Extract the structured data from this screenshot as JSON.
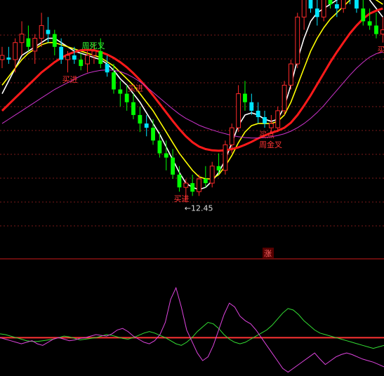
{
  "colors": {
    "background": "#000000",
    "grid": "#7a1a1a",
    "candle_up": "#ff2a2a",
    "candle_down_fill": "#00ff00",
    "candle_flat": "#00e5ff",
    "ma_white": "#ffffff",
    "ma_yellow": "#ffff00",
    "ma_red": "#ff1a1a",
    "ma_magenta": "#cc33cc",
    "ind_green": "#33dd33",
    "ind_magenta": "#dd44dd",
    "signal_red": "#ff3333",
    "signal_green": "#33ff33",
    "price_label": "#dddddd"
  },
  "labels": {
    "rise_tag": "涨",
    "low_price": "←12.45"
  },
  "chart_data": [
    {
      "type": "candlestick",
      "title": "",
      "ylim": [
        11.6,
        17.2
      ],
      "grid": true,
      "min_price": 12.45,
      "candles": [
        {
          "o": 15.9,
          "h": 16.1,
          "l": 15.6,
          "c": 15.8,
          "k": "up"
        },
        {
          "o": 15.8,
          "h": 16.1,
          "l": 15.7,
          "c": 15.85,
          "k": "cyan"
        },
        {
          "o": 15.8,
          "h": 16.3,
          "l": 15.5,
          "c": 16.2,
          "k": "up"
        },
        {
          "o": 16.2,
          "h": 16.7,
          "l": 15.9,
          "c": 16.4,
          "k": "up"
        },
        {
          "o": 16.3,
          "h": 16.6,
          "l": 16.0,
          "c": 16.1,
          "k": "down"
        },
        {
          "o": 16.0,
          "h": 16.4,
          "l": 15.7,
          "c": 16.3,
          "k": "up"
        },
        {
          "o": 16.3,
          "h": 16.9,
          "l": 16.1,
          "c": 16.6,
          "k": "up"
        },
        {
          "o": 16.5,
          "h": 16.8,
          "l": 16.2,
          "c": 16.4,
          "k": "cyan"
        },
        {
          "o": 16.4,
          "h": 16.5,
          "l": 15.9,
          "c": 16.1,
          "k": "down"
        },
        {
          "o": 16.1,
          "h": 16.3,
          "l": 15.7,
          "c": 15.8,
          "k": "cyan"
        },
        {
          "o": 15.8,
          "h": 16.0,
          "l": 15.5,
          "c": 15.9,
          "k": "up"
        },
        {
          "o": 15.9,
          "h": 16.1,
          "l": 15.7,
          "c": 15.8,
          "k": "cyan"
        },
        {
          "o": 15.8,
          "h": 15.95,
          "l": 15.55,
          "c": 15.65,
          "k": "down"
        },
        {
          "o": 15.7,
          "h": 16.0,
          "l": 15.5,
          "c": 15.9,
          "k": "up"
        },
        {
          "o": 15.9,
          "h": 16.2,
          "l": 15.7,
          "c": 16.0,
          "k": "up"
        },
        {
          "o": 16.0,
          "h": 16.3,
          "l": 15.6,
          "c": 15.7,
          "k": "down"
        },
        {
          "o": 15.7,
          "h": 15.9,
          "l": 15.4,
          "c": 15.5,
          "k": "cyan"
        },
        {
          "o": 15.5,
          "h": 15.7,
          "l": 15.0,
          "c": 15.1,
          "k": "down"
        },
        {
          "o": 15.1,
          "h": 15.3,
          "l": 14.7,
          "c": 15.0,
          "k": "down"
        },
        {
          "o": 15.0,
          "h": 15.2,
          "l": 14.6,
          "c": 14.8,
          "k": "down"
        },
        {
          "o": 14.8,
          "h": 15.0,
          "l": 14.4,
          "c": 14.5,
          "k": "down"
        },
        {
          "o": 14.5,
          "h": 14.7,
          "l": 14.1,
          "c": 14.3,
          "k": "down"
        },
        {
          "o": 14.3,
          "h": 14.5,
          "l": 14.0,
          "c": 14.2,
          "k": "cyan"
        },
        {
          "o": 14.2,
          "h": 14.4,
          "l": 13.8,
          "c": 13.9,
          "k": "down"
        },
        {
          "o": 13.9,
          "h": 14.1,
          "l": 13.5,
          "c": 13.6,
          "k": "down"
        },
        {
          "o": 13.6,
          "h": 13.9,
          "l": 13.2,
          "c": 13.5,
          "k": "down"
        },
        {
          "o": 13.5,
          "h": 13.7,
          "l": 13.0,
          "c": 13.1,
          "k": "down"
        },
        {
          "o": 13.1,
          "h": 13.3,
          "l": 12.7,
          "c": 12.8,
          "k": "down"
        },
        {
          "o": 12.8,
          "h": 13.0,
          "l": 12.45,
          "c": 12.9,
          "k": "up"
        },
        {
          "o": 12.9,
          "h": 13.1,
          "l": 12.6,
          "c": 12.7,
          "k": "down"
        },
        {
          "o": 12.7,
          "h": 13.1,
          "l": 12.6,
          "c": 13.0,
          "k": "up"
        },
        {
          "o": 13.0,
          "h": 13.3,
          "l": 12.8,
          "c": 12.9,
          "k": "down"
        },
        {
          "o": 12.9,
          "h": 13.4,
          "l": 12.8,
          "c": 13.3,
          "k": "up"
        },
        {
          "o": 13.3,
          "h": 13.6,
          "l": 13.1,
          "c": 13.2,
          "k": "down"
        },
        {
          "o": 13.2,
          "h": 13.9,
          "l": 13.1,
          "c": 13.8,
          "k": "up"
        },
        {
          "o": 13.8,
          "h": 14.3,
          "l": 13.6,
          "c": 14.2,
          "k": "up"
        },
        {
          "o": 14.2,
          "h": 15.2,
          "l": 14.1,
          "c": 15.0,
          "k": "up"
        },
        {
          "o": 15.0,
          "h": 15.3,
          "l": 14.6,
          "c": 14.8,
          "k": "down"
        },
        {
          "o": 14.8,
          "h": 15.0,
          "l": 14.5,
          "c": 14.6,
          "k": "cyan"
        },
        {
          "o": 14.6,
          "h": 14.8,
          "l": 14.3,
          "c": 14.45,
          "k": "cyan"
        },
        {
          "o": 14.45,
          "h": 14.6,
          "l": 14.2,
          "c": 14.3,
          "k": "cyan"
        },
        {
          "o": 14.3,
          "h": 14.5,
          "l": 14.1,
          "c": 14.2,
          "k": "up"
        },
        {
          "o": 14.2,
          "h": 14.7,
          "l": 14.1,
          "c": 14.6,
          "k": "up"
        },
        {
          "o": 14.6,
          "h": 15.3,
          "l": 14.5,
          "c": 15.2,
          "k": "up"
        },
        {
          "o": 15.2,
          "h": 15.8,
          "l": 15.1,
          "c": 15.7,
          "k": "up"
        },
        {
          "o": 15.7,
          "h": 16.9,
          "l": 15.6,
          "c": 16.8,
          "k": "up"
        },
        {
          "o": 16.8,
          "h": 17.4,
          "l": 16.5,
          "c": 17.3,
          "k": "up"
        },
        {
          "o": 17.3,
          "h": 17.5,
          "l": 16.9,
          "c": 17.0,
          "k": "cyan"
        },
        {
          "o": 17.0,
          "h": 17.3,
          "l": 16.6,
          "c": 16.8,
          "k": "cyan"
        },
        {
          "o": 16.8,
          "h": 17.4,
          "l": 16.7,
          "c": 17.3,
          "k": "up"
        },
        {
          "o": 17.3,
          "h": 17.6,
          "l": 17.0,
          "c": 17.1,
          "k": "down"
        },
        {
          "o": 17.1,
          "h": 17.3,
          "l": 16.8,
          "c": 17.0,
          "k": "cyan"
        },
        {
          "o": 17.0,
          "h": 17.5,
          "l": 16.9,
          "c": 17.4,
          "k": "up"
        },
        {
          "o": 17.4,
          "h": 17.7,
          "l": 17.1,
          "c": 17.2,
          "k": "cyan"
        },
        {
          "o": 17.2,
          "h": 17.4,
          "l": 16.9,
          "c": 17.0,
          "k": "cyan"
        },
        {
          "o": 17.0,
          "h": 17.3,
          "l": 16.6,
          "c": 16.7,
          "k": "down"
        },
        {
          "o": 16.7,
          "h": 17.0,
          "l": 16.5,
          "c": 16.6,
          "k": "down"
        },
        {
          "o": 16.6,
          "h": 16.9,
          "l": 16.3,
          "c": 16.4,
          "k": "down"
        },
        {
          "o": 16.4,
          "h": 16.8,
          "l": 16.2,
          "c": 16.5,
          "k": "up"
        }
      ],
      "series": [
        {
          "color_key": "ma_white",
          "values": [
            15.0,
            15.3,
            15.6,
            15.9,
            16.0,
            16.1,
            16.2,
            16.3,
            16.3,
            16.2,
            16.1,
            16.0,
            15.95,
            15.9,
            15.85,
            15.8,
            15.7,
            15.55,
            15.35,
            15.2,
            15.0,
            14.8,
            14.55,
            14.3,
            14.05,
            13.75,
            13.45,
            13.15,
            12.9,
            12.8,
            12.75,
            12.8,
            12.95,
            13.15,
            13.45,
            13.85,
            14.25,
            14.5,
            14.55,
            14.5,
            14.4,
            14.35,
            14.4,
            14.7,
            15.2,
            15.8,
            16.3,
            16.7,
            16.9,
            17.0,
            17.1,
            17.2,
            17.3,
            17.4,
            17.45,
            17.4,
            17.2,
            17.0,
            16.8
          ]
        },
        {
          "color_key": "ma_yellow",
          "values": [
            15.2,
            15.4,
            15.6,
            15.8,
            15.95,
            16.05,
            16.15,
            16.2,
            16.2,
            16.15,
            16.1,
            16.05,
            16.0,
            15.95,
            15.9,
            15.85,
            15.75,
            15.65,
            15.5,
            15.35,
            15.2,
            15.0,
            14.8,
            14.6,
            14.35,
            14.1,
            13.85,
            13.6,
            13.4,
            13.2,
            13.05,
            13.0,
            13.0,
            13.1,
            13.3,
            13.55,
            13.85,
            14.1,
            14.25,
            14.3,
            14.3,
            14.3,
            14.35,
            14.5,
            14.8,
            15.2,
            15.6,
            16.0,
            16.3,
            16.55,
            16.75,
            16.9,
            17.05,
            17.2,
            17.3,
            17.35,
            17.3,
            17.2,
            17.1
          ]
        },
        {
          "color_key": "ma_red",
          "values": [
            14.6,
            14.75,
            14.9,
            15.05,
            15.2,
            15.35,
            15.5,
            15.62,
            15.74,
            15.84,
            15.92,
            15.98,
            16.02,
            16.03,
            16.02,
            15.98,
            15.92,
            15.84,
            15.74,
            15.62,
            15.48,
            15.32,
            15.15,
            14.96,
            14.76,
            14.56,
            14.36,
            14.17,
            14.0,
            13.86,
            13.76,
            13.7,
            13.67,
            13.66,
            13.67,
            13.7,
            13.74,
            13.8,
            13.87,
            13.95,
            14.02,
            14.08,
            14.13,
            14.2,
            14.32,
            14.5,
            14.72,
            14.96,
            15.22,
            15.48,
            15.74,
            15.98,
            16.2,
            16.42,
            16.6,
            16.76,
            16.88,
            16.95,
            17.0
          ]
        },
        {
          "color_key": "ma_magenta",
          "values": [
            14.3,
            14.4,
            14.5,
            14.6,
            14.7,
            14.8,
            14.9,
            15.0,
            15.1,
            15.18,
            15.26,
            15.34,
            15.42,
            15.48,
            15.52,
            15.55,
            15.56,
            15.55,
            15.52,
            15.46,
            15.38,
            15.28,
            15.16,
            15.03,
            14.9,
            14.77,
            14.64,
            14.52,
            14.42,
            14.34,
            14.26,
            14.2,
            14.15,
            14.1,
            14.06,
            14.02,
            13.99,
            13.97,
            13.96,
            13.96,
            13.97,
            13.99,
            14.02,
            14.06,
            14.12,
            14.2,
            14.3,
            14.42,
            14.56,
            14.72,
            14.9,
            15.08,
            15.26,
            15.44,
            15.6,
            15.74,
            15.86,
            15.94,
            15.98
          ]
        }
      ],
      "annotations": [
        {
          "i": 10,
          "text": "买进",
          "pos": "below",
          "color_key": "signal_red"
        },
        {
          "i": 13,
          "text": "周死叉",
          "pos": "above",
          "color_key": "signal_green"
        },
        {
          "i": 20,
          "text": "买进",
          "pos": "above",
          "color_key": "signal_red"
        },
        {
          "i": 27,
          "text": "买进",
          "pos": "below",
          "color_key": "signal_red"
        },
        {
          "i": 40,
          "text": "买点",
          "pos": "below",
          "color_key": "signal_red"
        },
        {
          "i": 40,
          "text": "周金叉",
          "pos": "below2",
          "color_key": "signal_red"
        },
        {
          "i": 58,
          "text": "买",
          "pos": "below",
          "color_key": "signal_red"
        }
      ]
    },
    {
      "type": "line",
      "title": "",
      "ylim": [
        -50,
        100
      ],
      "zero_line": 0,
      "grid": false,
      "series": [
        {
          "color_key": "ind_green",
          "values": [
            5,
            4,
            2,
            0,
            -2,
            -4,
            -5,
            -5,
            -4,
            -3,
            -2,
            0,
            2,
            1,
            -1,
            -3,
            -2,
            -1,
            0,
            2,
            4,
            3,
            1,
            -1,
            -2,
            0,
            3,
            6,
            8,
            6,
            3,
            0,
            -4,
            -8,
            -10,
            -6,
            0,
            8,
            14,
            20,
            18,
            12,
            4,
            -2,
            -6,
            -8,
            -6,
            -2,
            2,
            6,
            10,
            16,
            24,
            32,
            38,
            36,
            30,
            22,
            16,
            10,
            6,
            4,
            2,
            0,
            -2,
            -4,
            -6,
            -8,
            -10,
            -12,
            -14,
            -12,
            -10
          ]
        },
        {
          "color_key": "ind_magenta",
          "values": [
            0,
            -2,
            -4,
            -6,
            -8,
            -6,
            -4,
            -8,
            -10,
            -6,
            -2,
            0,
            -2,
            -4,
            -3,
            -1,
            0,
            2,
            4,
            3,
            2,
            5,
            10,
            12,
            8,
            2,
            -2,
            -6,
            -8,
            -4,
            4,
            20,
            50,
            65,
            40,
            10,
            -5,
            -20,
            -30,
            -25,
            -10,
            10,
            30,
            45,
            40,
            28,
            22,
            18,
            10,
            0,
            -10,
            -20,
            -30,
            -40,
            -45,
            -40,
            -35,
            -30,
            -25,
            -20,
            -28,
            -35,
            -30,
            -25,
            -22,
            -20,
            -22,
            -25,
            -28,
            -30,
            -32,
            -35,
            -38
          ]
        }
      ]
    }
  ]
}
